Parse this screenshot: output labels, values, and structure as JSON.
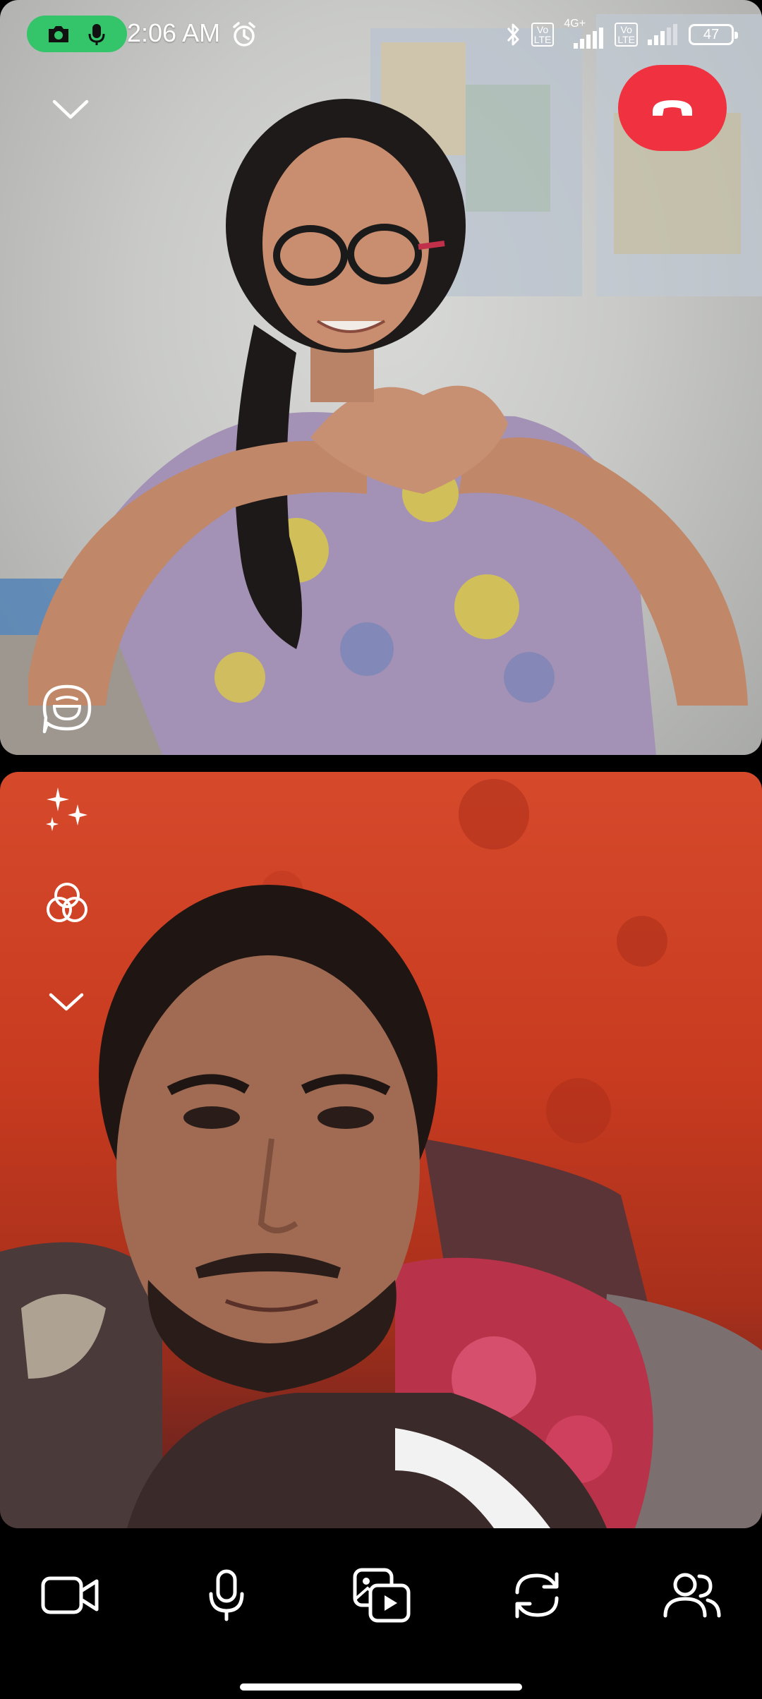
{
  "status_bar": {
    "time": "2:06 AM",
    "battery": "47",
    "network_label": "4G+",
    "volte_label_1": "Vo\nLTE",
    "volte_label_2": "Vo\nLTE",
    "icons": [
      "camera-icon",
      "microphone-icon",
      "alarm-icon",
      "bluetooth-icon",
      "signal-icon",
      "battery-icon"
    ],
    "rec_pill_color": "#34c46a"
  },
  "call": {
    "end_call_color": "#f0313f",
    "remote_controls": [
      "chevron-down-icon",
      "caption-icon"
    ],
    "self_controls": [
      "sparkles-icon",
      "filters-icon",
      "chevron-down-icon"
    ]
  },
  "bottom_bar": {
    "buttons": [
      "video-camera-icon",
      "microphone-icon",
      "media-share-icon",
      "switch-camera-icon",
      "participants-icon"
    ]
  }
}
